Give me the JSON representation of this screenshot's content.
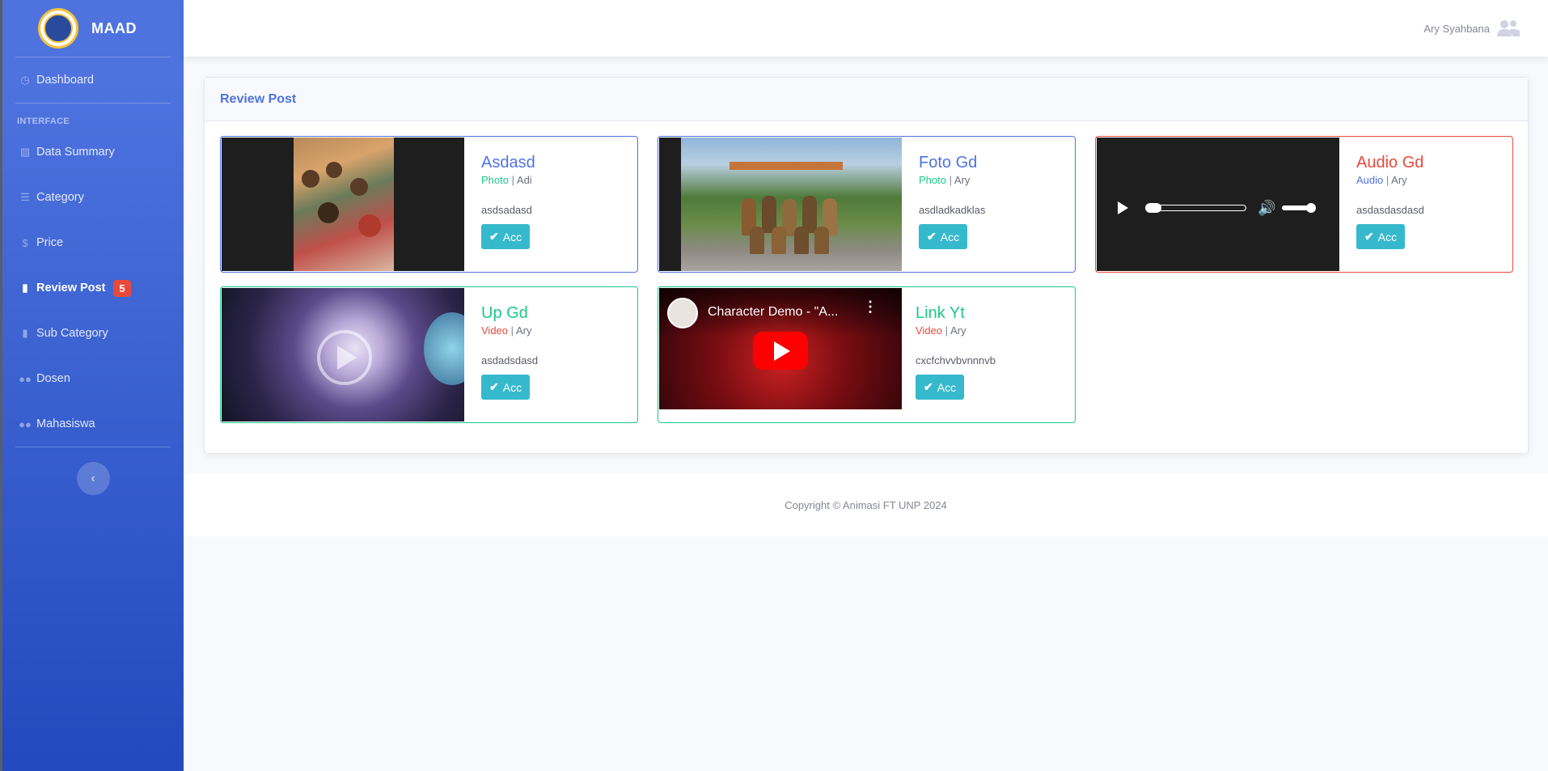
{
  "brand": {
    "name": "MAAD"
  },
  "sidebar": {
    "items_top": [
      {
        "label": "Dashboard",
        "icon": "tachometer-icon"
      }
    ],
    "heading": "INTERFACE",
    "items": [
      {
        "label": "Data Summary",
        "icon": "chart-area-icon"
      },
      {
        "label": "Category",
        "icon": "list-icon"
      },
      {
        "label": "Price",
        "icon": "dollar-icon"
      },
      {
        "label": "Review Post",
        "icon": "file-icon",
        "badge": "5",
        "active": true
      },
      {
        "label": "Sub Category",
        "icon": "file-icon"
      },
      {
        "label": "Dosen",
        "icon": "users-icon"
      },
      {
        "label": "Mahasiswa",
        "icon": "users-icon"
      }
    ],
    "toggle_icon": "chevron-left-icon"
  },
  "topbar": {
    "user_name": "Ary Syahbana",
    "user_icon": "users-icon"
  },
  "card": {
    "title": "Review Post"
  },
  "posts": [
    {
      "title": "Asdasd",
      "type": "Photo",
      "author": "Adi",
      "desc": "asdsadasd",
      "button": "Acc",
      "media": "photo"
    },
    {
      "title": "Foto Gd",
      "type": "Photo",
      "author": "Ary",
      "desc": "asdladkadklas",
      "button": "Acc",
      "media": "photo"
    },
    {
      "title": "Audio Gd",
      "type": "Audio",
      "author": "Ary",
      "desc": "asdasdasdasd",
      "button": "Acc",
      "media": "audio"
    },
    {
      "title": "Up Gd",
      "type": "Video",
      "author": "Ary",
      "desc": "asdadsdasd",
      "button": "Acc",
      "media": "video"
    },
    {
      "title": "Link Yt",
      "type": "Video",
      "author": "Ary",
      "desc": "cxcfchvvbvnnnvb",
      "button": "Acc",
      "media": "youtube",
      "embed_title": "Character Demo - \"A..."
    }
  ],
  "separator": "|",
  "footer": {
    "text": "Copyright © Animasi FT UNP 2024"
  },
  "colors": {
    "primary": "#4e73df",
    "danger": "#e74a3b",
    "success": "#1cc88a",
    "info": "#36b9cc"
  }
}
